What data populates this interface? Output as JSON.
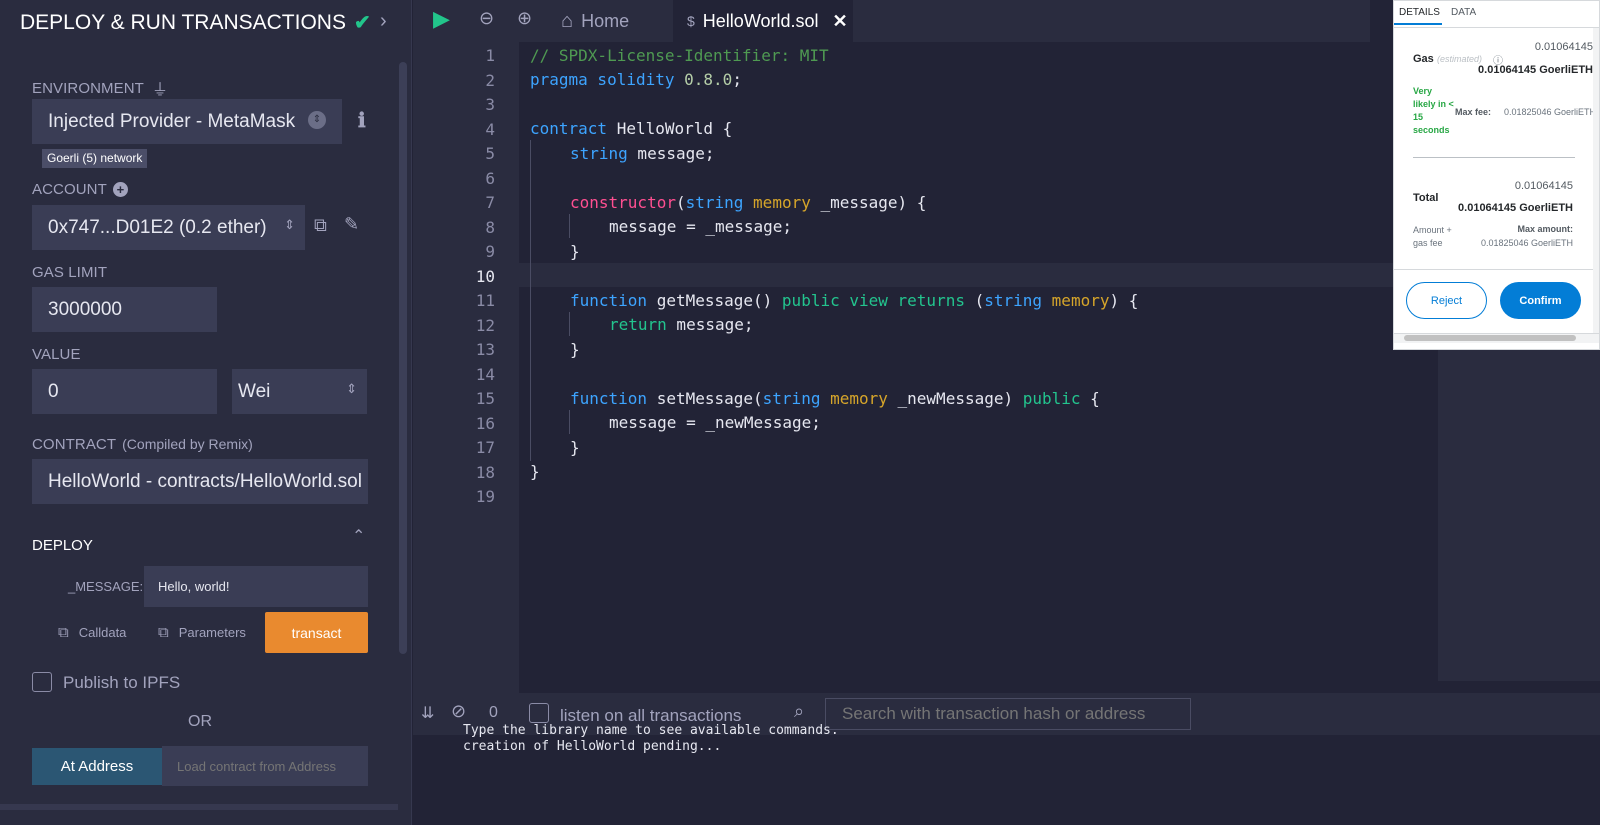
{
  "left_panel": {
    "title": "DEPLOY & RUN TRANSACTIONS",
    "environment_label": "ENVIRONMENT",
    "environment_value": "Injected Provider - MetaMask",
    "network_badge": "Goerli (5) network",
    "account_label": "ACCOUNT",
    "account_value": "0x747...D01E2 (0.2 ether)",
    "gas_limit_label": "GAS LIMIT",
    "gas_limit_value": "3000000",
    "value_label": "VALUE",
    "value_amount": "0",
    "value_unit": "Wei",
    "contract_label": "CONTRACT",
    "contract_note": "(Compiled by Remix)",
    "contract_value": "HelloWorld - contracts/HelloWorld.sol",
    "deploy_label": "DEPLOY",
    "message_param_label": "_MESSAGE:",
    "message_param_value": "Hello, world!",
    "calldata_label": "Calldata",
    "parameters_label": "Parameters",
    "transact_label": "transact",
    "publish_label": "Publish to IPFS",
    "or_label": "OR",
    "at_address_label": "At Address",
    "load_contract_placeholder": "Load contract from Address"
  },
  "tabs": {
    "home_label": "Home",
    "file_label": "HelloWorld.sol"
  },
  "editor": {
    "active_line": 10,
    "line_numbers": [
      "1",
      "2",
      "3",
      "4",
      "5",
      "6",
      "7",
      "8",
      "9",
      "10",
      "11",
      "12",
      "13",
      "14",
      "15",
      "16",
      "17",
      "18",
      "19"
    ],
    "code_tokens": {
      "l1": "// SPDX-License-Identifier: MIT",
      "l2_kw": "pragma solidity",
      "l2_ver": "0.8.0",
      "l2_end": ";",
      "l4_kw": "contract",
      "l4_rest": " HelloWorld {",
      "l5_ty": "string",
      "l5_rest": " message;",
      "l7_fn": "constructor",
      "l7_p1": "(",
      "l7_ty": "string",
      "l7_mem": "memory",
      "l7_rest": " _message) {",
      "l8": "message = _message;",
      "l9": "}",
      "l11_kw": "function",
      "l11_name": " getMessage() ",
      "l11_pub": "public",
      "l11_view": "view",
      "l11_ret": "returns",
      "l11_p": " (",
      "l11_ty": "string",
      "l11_mem": "memory",
      "l11_end": ") {",
      "l12_ret": "return",
      "l12_rest": " message;",
      "l13": "}",
      "l15_kw": "function",
      "l15_name": " setMessage(",
      "l15_ty": "string",
      "l15_mem": "memory",
      "l15_rest": " _newMessage) ",
      "l15_pub": "public",
      "l15_end": " {",
      "l16": "message = _newMessage;",
      "l17": "}",
      "l18": "}"
    }
  },
  "terminal": {
    "count": "0",
    "listen_label": "listen on all transactions",
    "search_placeholder": "Search with transaction hash or address",
    "line1": "Type the library name to see available commands.",
    "line2": "creation of HelloWorld pending..."
  },
  "metamask": {
    "tab_details": "DETAILS",
    "tab_data": "DATA",
    "gas_label": "Gas",
    "gas_estimated": "(estimated)",
    "gas_value_small": "0.01064145",
    "gas_value_bold": "0.01064145 GoerliETH",
    "likely_text": "Very likely in < 15 seconds",
    "max_fee_label": "Max fee:",
    "max_fee_value": "0.01825046 GoerliETH",
    "total_label": "Total",
    "total_value_small": "0.01064145",
    "total_value_bold": "0.01064145 GoerliETH",
    "amount_gas_label": "Amount + gas fee",
    "max_amount_label": "Max amount:",
    "max_amount_value": "0.01825046 GoerliETH",
    "reject_label": "Reject",
    "confirm_label": "Confirm"
  },
  "colors": {
    "accent_orange": "#e98a2f",
    "check_green": "#22c58b",
    "mm_blue": "#037dd6"
  }
}
